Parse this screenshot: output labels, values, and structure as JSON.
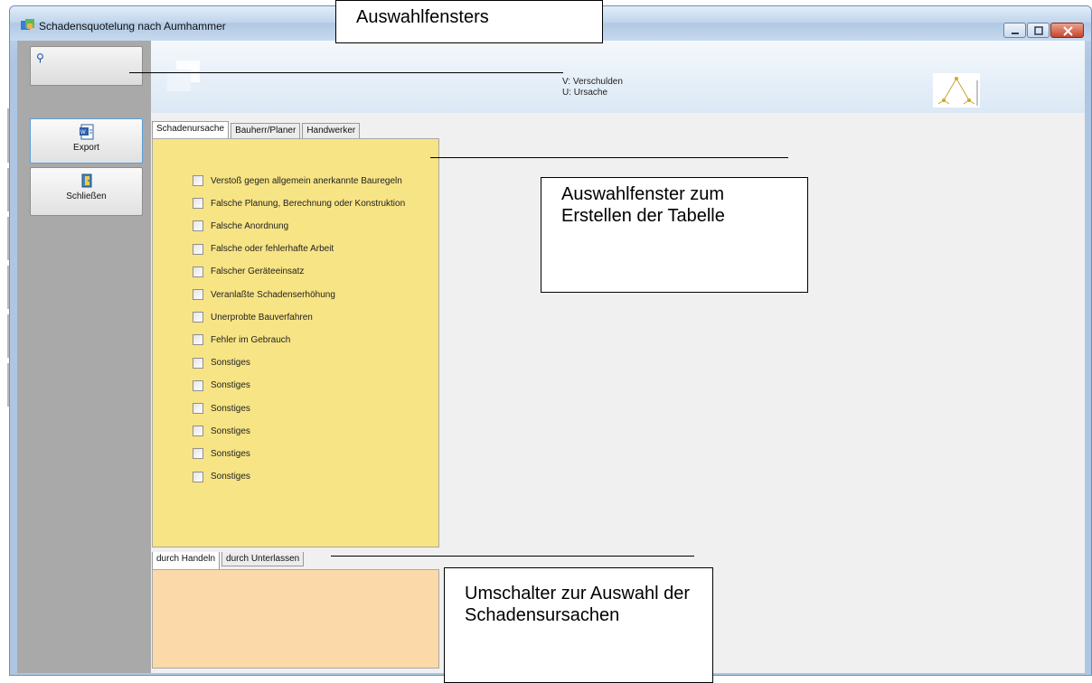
{
  "window": {
    "title": "Schadensquotelung nach Aumhammer"
  },
  "sidebar": {
    "export_label": "Export",
    "close_label": "Schließen"
  },
  "legend": {
    "line1": "V: Verschulden",
    "line2": "U: Ursache"
  },
  "tabs_top": [
    {
      "label": "Schadenursache",
      "active": true
    },
    {
      "label": "Bauherr/Planer",
      "active": false
    },
    {
      "label": "Handwerker",
      "active": false
    }
  ],
  "checkbox_items": [
    "Verstoß gegen allgemein anerkannte Bauregeln",
    "Falsche Planung, Berechnung oder Konstruktion",
    "Falsche Anordnung",
    "Falsche oder fehlerhafte Arbeit",
    "Falscher Geräteeinsatz",
    "Veranlaßte Schadenserhöhung",
    "Unerprobte Bauverfahren",
    "Fehler im Gebrauch",
    "Sonstiges",
    "Sonstiges",
    "Sonstiges",
    "Sonstiges",
    "Sonstiges",
    "Sonstiges"
  ],
  "tabs_bottom": [
    {
      "label": "durch Handeln",
      "active": true
    },
    {
      "label": "durch Unterlassen",
      "active": false
    }
  ],
  "callouts": {
    "top": "Auswahlfensters",
    "right": "Auswahlfenster zum Erstellen der Tabelle",
    "bottom": "Umschalter zur Auswahl der Schadensursachen"
  },
  "colors": {
    "tab_panel": "#f7e485",
    "bottom_panel": "#fcd9a8",
    "sidebar": "#a9a9a9"
  }
}
